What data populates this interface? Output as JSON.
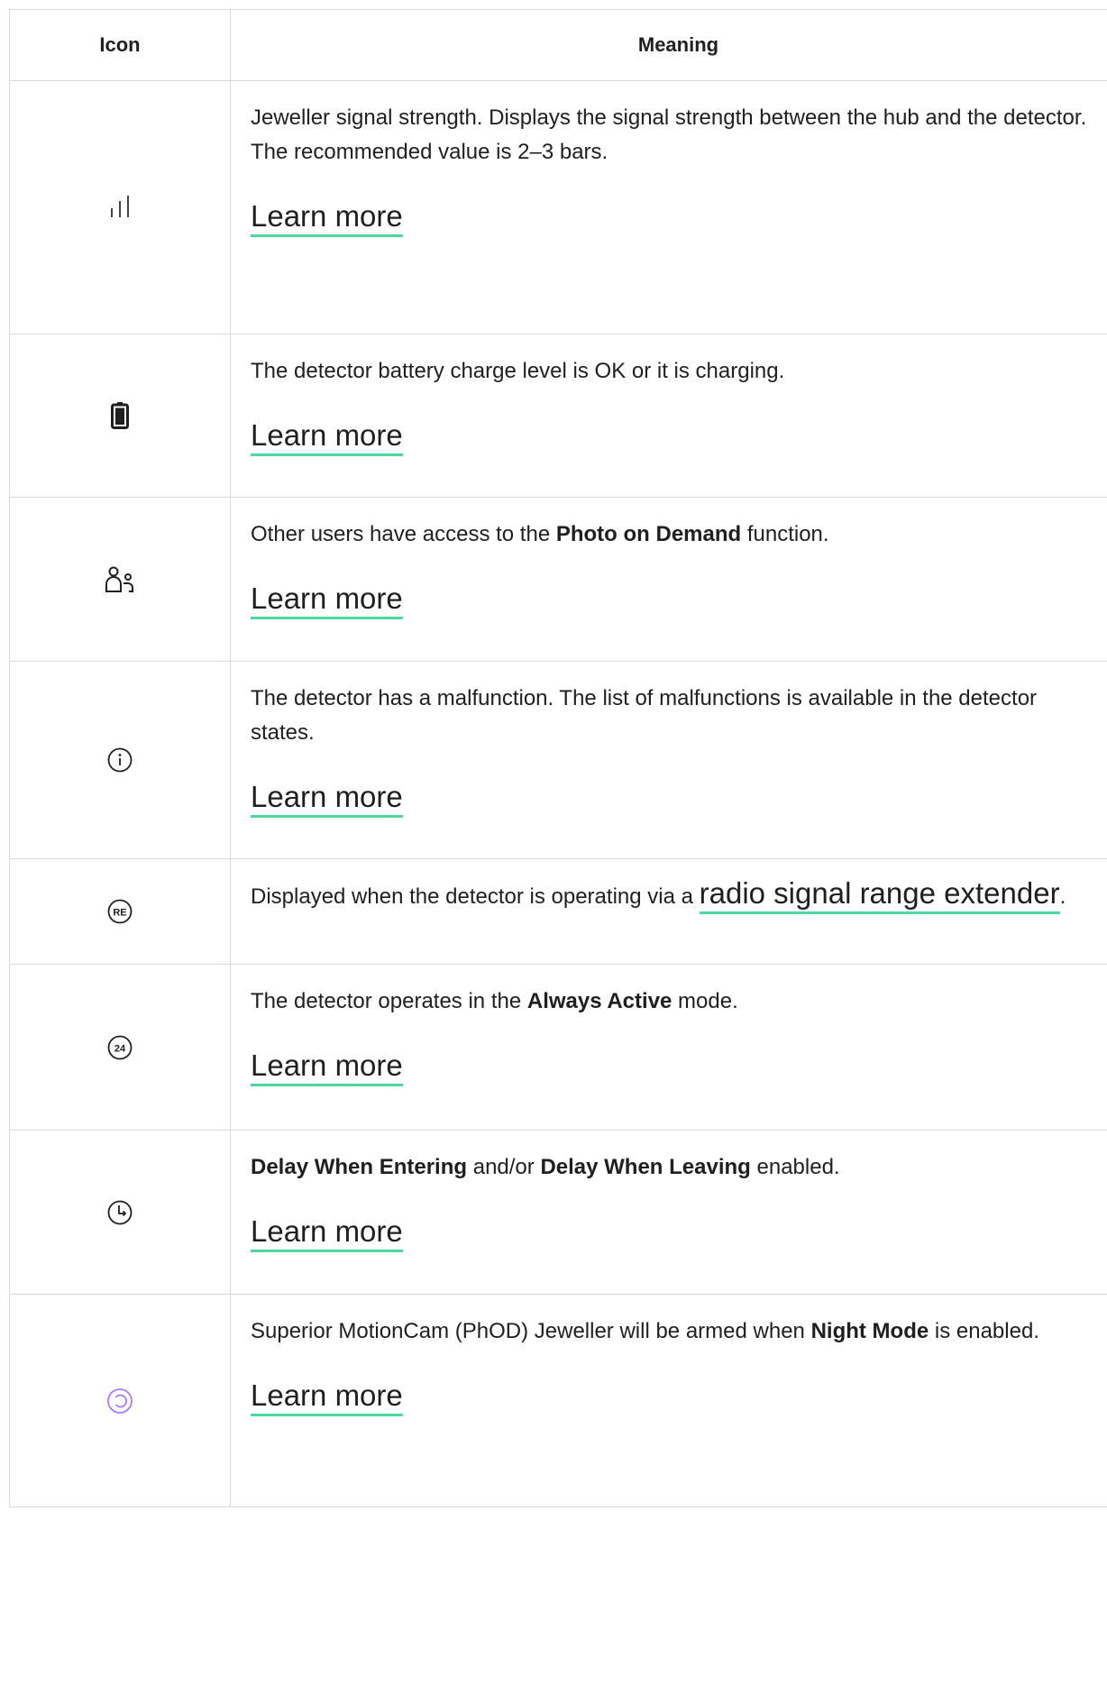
{
  "table": {
    "headers": {
      "icon": "Icon",
      "meaning": "Meaning"
    },
    "learn_more_label": "Learn more",
    "rows": [
      {
        "icon": "signal-strength-icon",
        "parts": [
          "Jeweller signal strength. Displays the signal strength between the hub and the detector. The recommended value is 2–3 bars."
        ]
      },
      {
        "icon": "battery-icon",
        "parts": [
          "The detector battery charge level is OK or it is charging."
        ]
      },
      {
        "icon": "users-icon",
        "parts": [
          "Other users have access to the ",
          "Photo on Demand",
          " function."
        ]
      },
      {
        "icon": "info-icon",
        "parts": [
          "The detector has a malfunction. The list of malfunctions is available in the detector states."
        ]
      },
      {
        "icon": "range-extender-icon",
        "parts": [
          "Displayed when the detector is operating via a ",
          "radio signal range extender",
          "."
        ]
      },
      {
        "icon": "always-active-24-icon",
        "parts": [
          "The detector operates in the ",
          "Always Active",
          " mode."
        ]
      },
      {
        "icon": "delay-clock-icon",
        "parts": [
          "Delay When Entering",
          " and/or ",
          "Delay When Leaving",
          " enabled."
        ]
      },
      {
        "icon": "night-mode-icon",
        "parts": [
          "Superior MotionCam (PhOD) Jeweller will be armed when ",
          "Night Mode",
          " is enabled."
        ]
      }
    ],
    "colors": {
      "link_underline": "#4cd9a0",
      "night_mode_icon": "#a87cff",
      "border": "#d9d9d9"
    }
  }
}
